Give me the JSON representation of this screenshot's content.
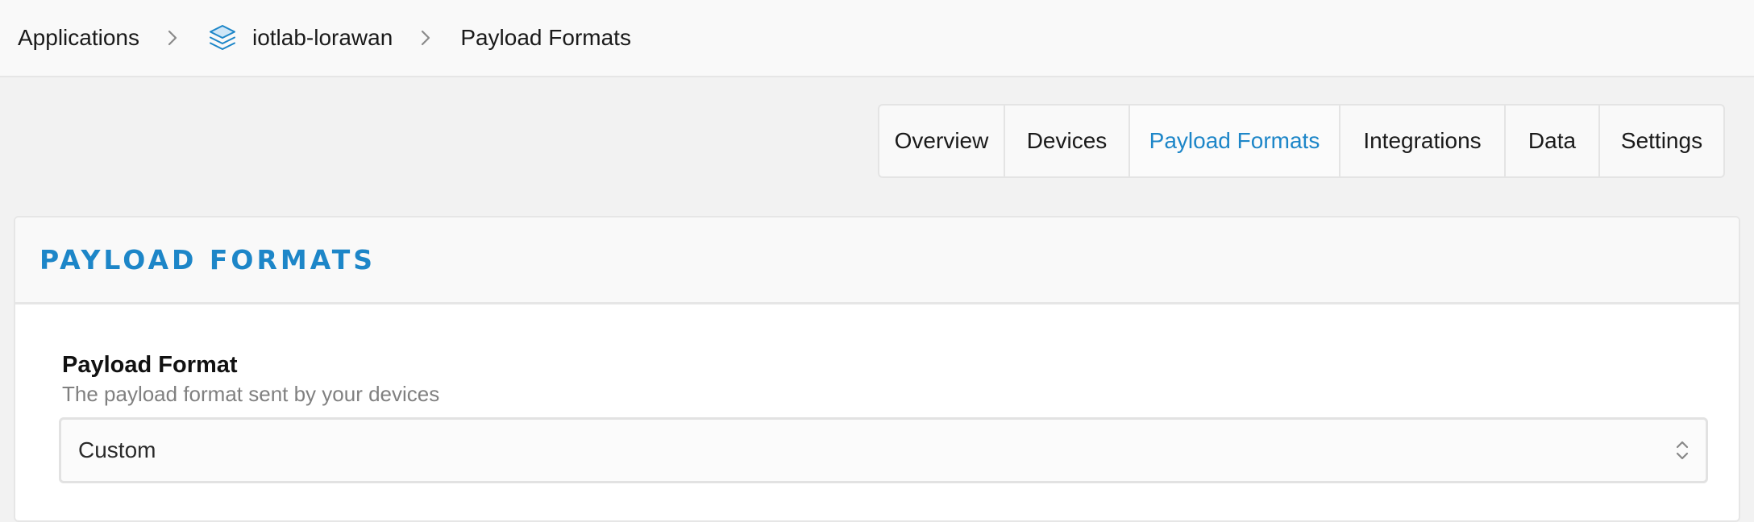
{
  "breadcrumb": {
    "items": [
      {
        "label": "Applications",
        "icon": null
      },
      {
        "label": "iotlab-lorawan",
        "icon": "layers-icon"
      },
      {
        "label": "Payload Formats",
        "icon": null
      }
    ],
    "separator_icon": "chevron-right-icon"
  },
  "tabs": [
    {
      "label": "Overview",
      "active": false
    },
    {
      "label": "Devices",
      "active": false
    },
    {
      "label": "Payload Formats",
      "active": true
    },
    {
      "label": "Integrations",
      "active": false
    },
    {
      "label": "Data",
      "active": false
    },
    {
      "label": "Settings",
      "active": false
    }
  ],
  "panel": {
    "title": "Payload Formats",
    "field": {
      "label": "Payload Format",
      "help": "The payload format sent by your devices",
      "value": "Custom",
      "indicator_icon": "chevron-updown-icon"
    }
  },
  "colors": {
    "accent": "#1d86c8",
    "background": "#f2f2f2",
    "surface": "#f9f9f9",
    "border": "#e6e6e6",
    "muted_text": "#808080"
  }
}
